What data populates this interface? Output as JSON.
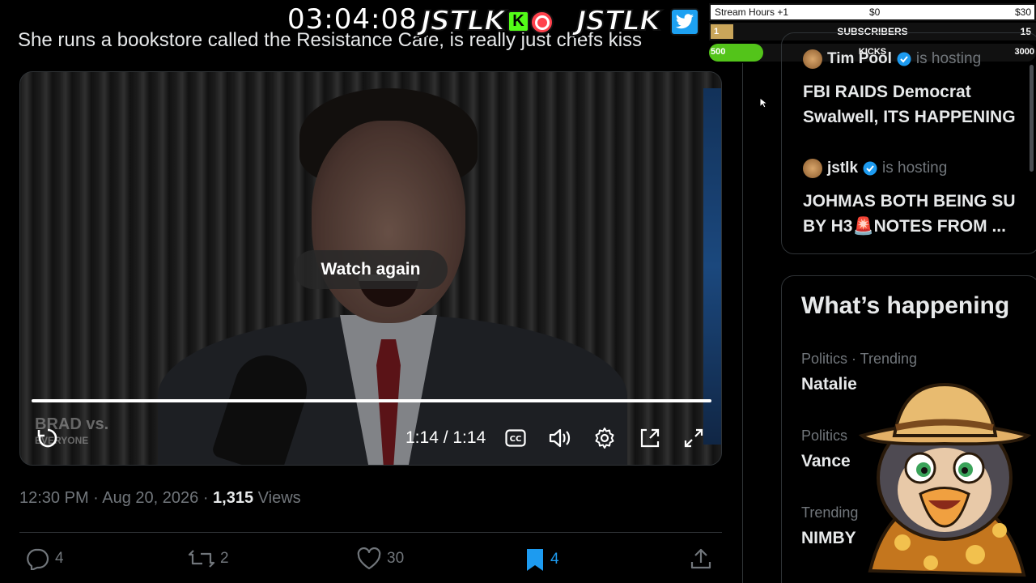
{
  "overlay": {
    "clock": "03:04:08",
    "brand_a": "JSTLK",
    "brand_k": "K",
    "brand_b": "JSTLK",
    "goals": {
      "stream_hours_label": "Stream Hours +1",
      "stream_hours_mid": "$0",
      "stream_hours_end": "$30",
      "subscribers_label": "SUBSCRIBERS",
      "subscribers_current": "1",
      "subscribers_target": "15",
      "kicks_label": "KICKS",
      "kicks_current": "500",
      "kicks_target": "3000",
      "kicks_fill_fraction": 0.167
    }
  },
  "tweet": {
    "text": "She runs a bookstore called the Resistance Cafe, is really just chefs kiss",
    "video": {
      "watch_again_label": "Watch again",
      "time": "1:14 / 1:14",
      "progress_fraction": 1.0,
      "watermark_line1": "BRAD vs.",
      "watermark_line2": "EVERYONE"
    },
    "timestamp": "12:30 PM · Aug 20, 2026 · ",
    "views_count": "1,315",
    "views_label": " Views",
    "actions": {
      "replies": "4",
      "reposts": "2",
      "likes": "30",
      "bookmarks": "4"
    }
  },
  "sidebar": {
    "hosting": [
      {
        "name": "Tim Pool",
        "status": "is hosting",
        "title_line1": "FBI RAIDS Democrat",
        "title_line2": "Swalwell, ITS HAPPENING"
      },
      {
        "name": "jstlk",
        "status": "is hosting",
        "title_line1": "JOHMAS BOTH BEING SU",
        "title_line2": "BY H3🚨NOTES FROM ..."
      }
    ],
    "whats_happening_title": "What’s happening",
    "trends": [
      {
        "meta": "Politics · Trending",
        "name": "Natalie"
      },
      {
        "meta": "Politics",
        "name": "Vance"
      },
      {
        "meta": "Trending",
        "name": "NIMBY"
      }
    ]
  },
  "colors": {
    "accent": "#1d9bf0",
    "muted": "#71767b",
    "kick_green": "#53fc18"
  }
}
